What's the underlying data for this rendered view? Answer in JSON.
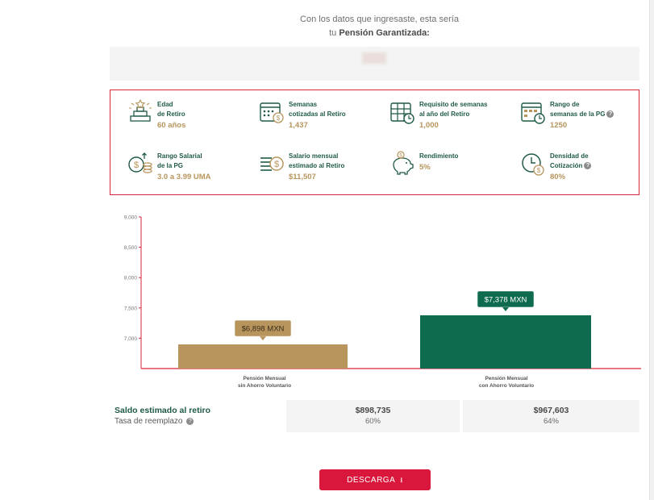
{
  "intro": {
    "line1": "Con los datos que ingresaste, esta sería",
    "line2_prefix": "tu",
    "line2_strong": "Pensión Garantizada:"
  },
  "info": [
    {
      "icon": "podium-icon",
      "label": "Edad\nde Retiro",
      "value": "60 años",
      "help": false
    },
    {
      "icon": "calendar-coins-icon",
      "label": "Semanas\ncotizadas al Retiro",
      "value": "1,437",
      "help": false
    },
    {
      "icon": "calendar-clock-icon",
      "label": "Requisito de semanas\nal año del Retiro",
      "value": "1,000",
      "help": false
    },
    {
      "icon": "calendar-range-icon",
      "label": "Rango de\nsemanas de la PG",
      "value": "1250",
      "help": true
    },
    {
      "icon": "salary-coins-icon",
      "label": "Rango Salarial\nde la PG",
      "value": "3.0 a 3.99 UMA",
      "help": false
    },
    {
      "icon": "money-bills-icon",
      "label": "Salario mensual\nestimado al Retiro",
      "value": "$11,507",
      "help": false
    },
    {
      "icon": "piggy-bank-icon",
      "label": "Rendimiento",
      "value": "5%",
      "help": false
    },
    {
      "icon": "clock-money-icon",
      "label": "Densidad de\nCotización",
      "value": "80%",
      "help": true
    }
  ],
  "chart_data": {
    "type": "bar",
    "categories": [
      "Pensión Mensual\nsin Ahorro Voluntario",
      "Pensión Mensual\ncon Ahorro Voluntario"
    ],
    "values": [
      6898,
      7378
    ],
    "data_labels": [
      "$6,898 MXN",
      "$7,378 MXN"
    ],
    "bar_colors": [
      "#b8955c",
      "#0f6b4f"
    ],
    "ylim": [
      6500,
      9000
    ],
    "yticks": [
      7000,
      7500,
      8000,
      8500,
      9000
    ],
    "ytick_labels": [
      "7,000",
      "7,500",
      "8,000",
      "8,500",
      "9,000"
    ],
    "axis_color": "#d9263b"
  },
  "results": {
    "label1": "Saldo estimado al retiro",
    "label2": "Tasa de reemplazo",
    "col1": {
      "balance": "$898,735",
      "rate": "60%"
    },
    "col2": {
      "balance": "$967,603",
      "rate": "64%"
    }
  },
  "download": {
    "label": "DESCARGA",
    "icon": "download-icon"
  },
  "colors": {
    "green": "#1f5a47",
    "gold": "#b8955c",
    "red": "#d9163c"
  }
}
